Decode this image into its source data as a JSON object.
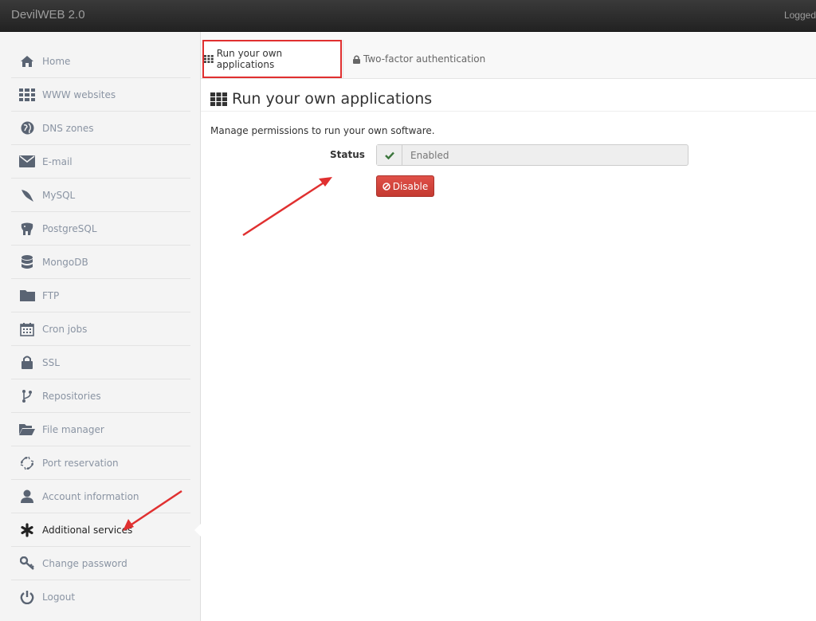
{
  "app": {
    "brand_plain": "Devil",
    "brand_bold": "WEB",
    "brand_version": " 2.0",
    "logged_text": "Logged"
  },
  "sidebar": {
    "items": [
      {
        "label": "Home",
        "icon": "home-icon"
      },
      {
        "label": "WWW websites",
        "icon": "grid-icon"
      },
      {
        "label": "DNS zones",
        "icon": "globe-icon"
      },
      {
        "label": "E-mail",
        "icon": "envelope-icon"
      },
      {
        "label": "MySQL",
        "icon": "dolphin-icon"
      },
      {
        "label": "PostgreSQL",
        "icon": "elephant-icon"
      },
      {
        "label": "MongoDB",
        "icon": "database-icon"
      },
      {
        "label": "FTP",
        "icon": "folder-icon"
      },
      {
        "label": "Cron jobs",
        "icon": "calendar-icon"
      },
      {
        "label": "SSL",
        "icon": "lock-icon"
      },
      {
        "label": "Repositories",
        "icon": "branch-icon"
      },
      {
        "label": "File manager",
        "icon": "folder-open-icon"
      },
      {
        "label": "Port reservation",
        "icon": "broken-link-icon"
      },
      {
        "label": "Account information",
        "icon": "user-icon"
      },
      {
        "label": "Additional services",
        "icon": "asterisk-icon",
        "active": true
      },
      {
        "label": "Change password",
        "icon": "key-icon"
      },
      {
        "label": "Logout",
        "icon": "power-icon"
      }
    ]
  },
  "tabs": [
    {
      "label": "Run your own applications",
      "icon": "grid-icon",
      "active": true
    },
    {
      "label": "Two-factor authentication",
      "icon": "lock-icon"
    }
  ],
  "main": {
    "title": "Run your own applications",
    "description": "Manage permissions to run your own software.",
    "status_label": "Status",
    "status_value": "Enabled",
    "disable_label": "Disable"
  },
  "colors": {
    "highlight": "#e03030",
    "danger_button": "#d9534f",
    "check_green": "#3c763d"
  }
}
